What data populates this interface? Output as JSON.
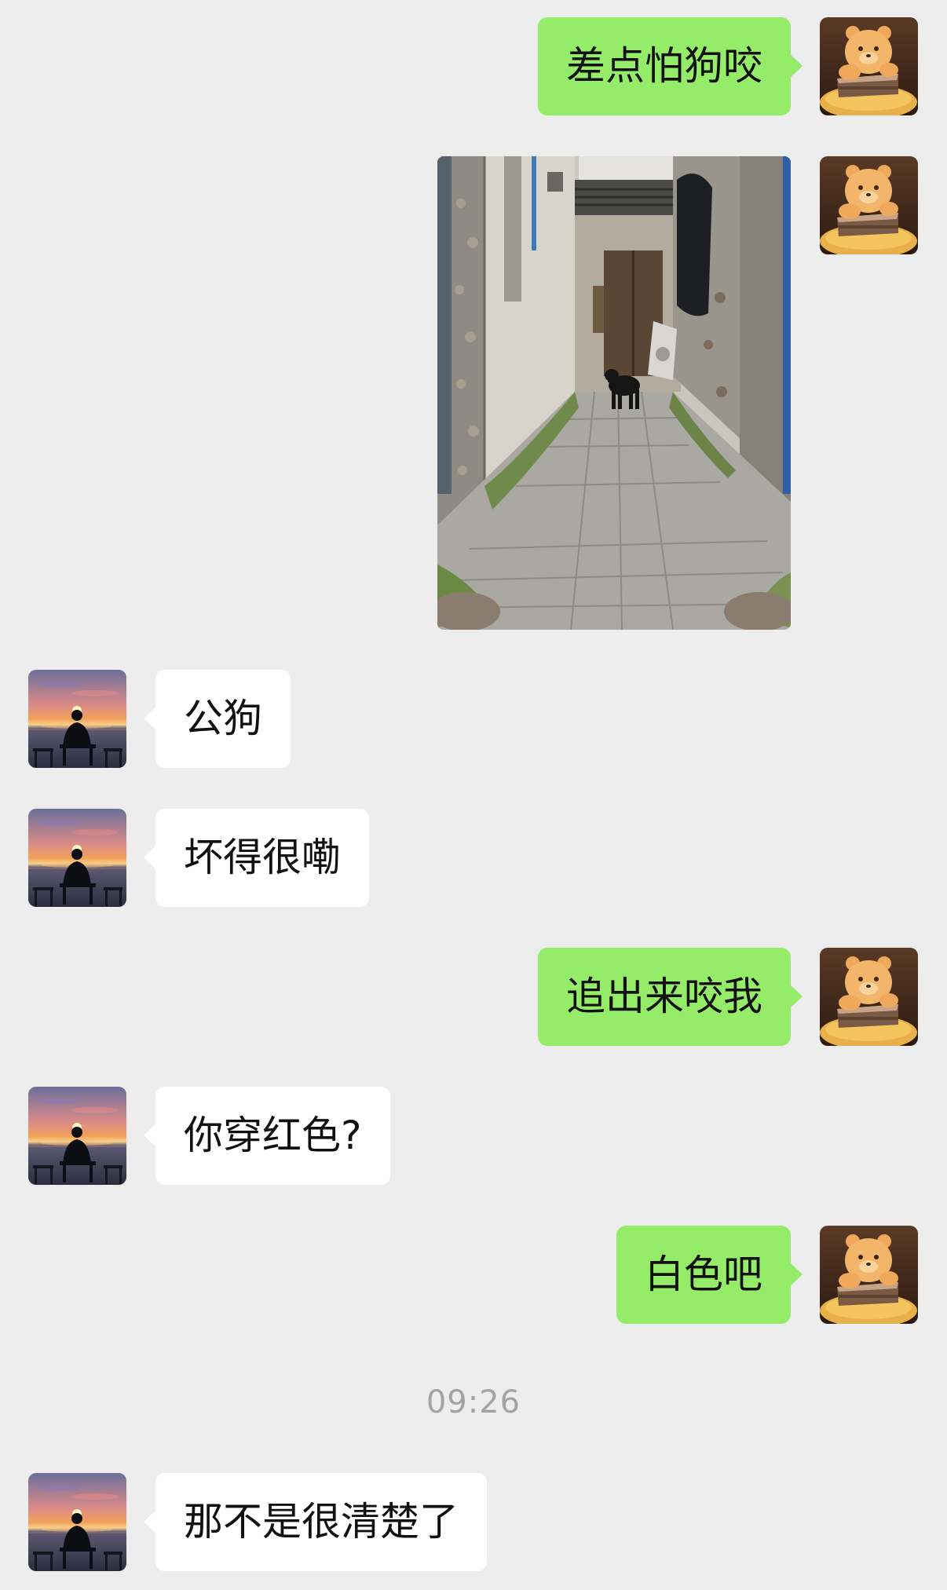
{
  "messages": [
    {
      "side": "right",
      "type": "text",
      "text": "差点怕狗咬"
    },
    {
      "side": "right",
      "type": "image",
      "image": "alley-dog-photo"
    },
    {
      "side": "left",
      "type": "text",
      "text": "公狗"
    },
    {
      "side": "left",
      "type": "text",
      "text": "坏得很嘞"
    },
    {
      "side": "right",
      "type": "text",
      "text": "追出来咬我"
    },
    {
      "side": "left",
      "type": "text",
      "text": "你穿红色?"
    },
    {
      "side": "right",
      "type": "text",
      "text": "白色吧"
    },
    {
      "side": "left",
      "type": "text",
      "text": "那不是很清楚了"
    }
  ],
  "timestamp": "09:26",
  "avatars": {
    "self": "bear-cake-avatar",
    "contact": "sunset-silhouette-avatar"
  },
  "colors": {
    "background": "#ededed",
    "outgoing_bubble": "#95ec69",
    "incoming_bubble": "#ffffff",
    "timestamp_text": "#a3a3a3"
  }
}
